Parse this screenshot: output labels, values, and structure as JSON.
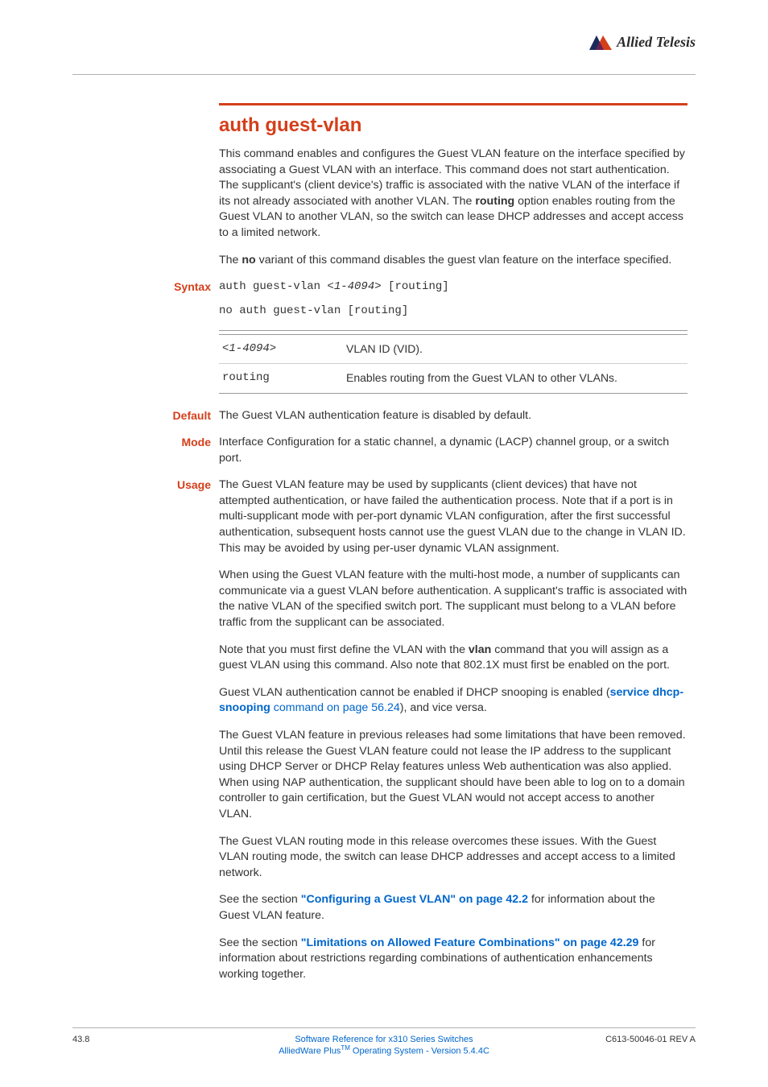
{
  "brand": {
    "name": "Allied Telesis"
  },
  "title": "auth guest-vlan",
  "intro_p1_a": "This command enables and configures the Guest VLAN feature on the interface specified by associating a Guest VLAN with an interface. This command does not start authentication. The supplicant's (client device's) traffic is associated with the native VLAN of the interface if its not already associated with another VLAN. The ",
  "intro_p1_bold": "routing",
  "intro_p1_b": " option enables routing from the Guest VLAN to another VLAN, so the switch can lease DHCP addresses and accept access to a limited network.",
  "intro_p2_a": "The ",
  "intro_p2_bold": "no",
  "intro_p2_b": " variant of this command disables the guest vlan feature on the interface specified.",
  "labels": {
    "syntax": "Syntax",
    "default": "Default",
    "mode": "Mode",
    "usage": "Usage"
  },
  "syntax": {
    "line1_a": "auth guest-vlan <",
    "line1_param": "1-4094",
    "line1_b": "> [routing]",
    "line2": "no auth guest-vlan [routing]"
  },
  "param_table": {
    "rows": [
      {
        "param": "<1-4094>",
        "desc": "VLAN ID (VID)."
      },
      {
        "param": "routing",
        "desc": "Enables routing from the Guest VLAN to other VLANs."
      }
    ]
  },
  "default_text": "The Guest VLAN authentication feature is disabled by default.",
  "mode_text": "Interface Configuration for a static channel, a dynamic (LACP) channel group, or a switch port.",
  "usage": {
    "p1": "The Guest VLAN feature may be used by supplicants (client devices) that have not attempted authentication, or have failed the authentication process. Note that if a port is in multi-supplicant mode with per-port dynamic VLAN configuration, after the first successful authentication, subsequent hosts cannot use the guest VLAN due to the change in VLAN ID. This may be avoided by using per-user dynamic VLAN assignment.",
    "p2": "When using the Guest VLAN feature with the multi-host mode, a number of supplicants can communicate via a guest VLAN before authentication. A supplicant's traffic is associated with the native VLAN of the specified switch port. The supplicant must belong to a VLAN before traffic from the supplicant can be associated.",
    "p3_a": "Note that you must first define the VLAN with the ",
    "p3_bold": "vlan",
    "p3_b": " command that you will assign as a guest VLAN using this command. Also note that 802.1X must first be enabled on the port.",
    "p4_a": "Guest VLAN authentication cannot be enabled if DHCP snooping is enabled (",
    "p4_link1": "service dhcp-snooping",
    "p4_link2": " command on page 56.24",
    "p4_b": "), and vice versa.",
    "p5": "The Guest VLAN feature in previous releases had some limitations that have been removed. Until this release the Guest VLAN feature could not lease the IP address to the supplicant using DHCP Server or DHCP Relay features unless Web authentication was also applied. When using NAP authentication, the supplicant should have been able to log on to a domain controller to gain certification, but the Guest VLAN would not accept access to another VLAN.",
    "p6": "The Guest VLAN routing mode in this release overcomes these issues. With the Guest VLAN routing mode, the switch can lease DHCP addresses and accept access to a limited network.",
    "p7_a": "See the section ",
    "p7_link": "\"Configuring a Guest VLAN\" on page 42.2",
    "p7_b": " for information about the Guest VLAN feature.",
    "p8_a": "See the section ",
    "p8_link": "\"Limitations on Allowed Feature Combinations\" on page 42.29",
    "p8_b": " for information about restrictions regarding combinations of authentication enhancements working together."
  },
  "footer": {
    "left": "43.8",
    "center1": "Software Reference for x310 Series Switches",
    "center2_a": "AlliedWare Plus",
    "center2_tm": "TM",
    "center2_b": " Operating System  - Version 5.4.4C",
    "right": "C613-50046-01 REV A"
  }
}
